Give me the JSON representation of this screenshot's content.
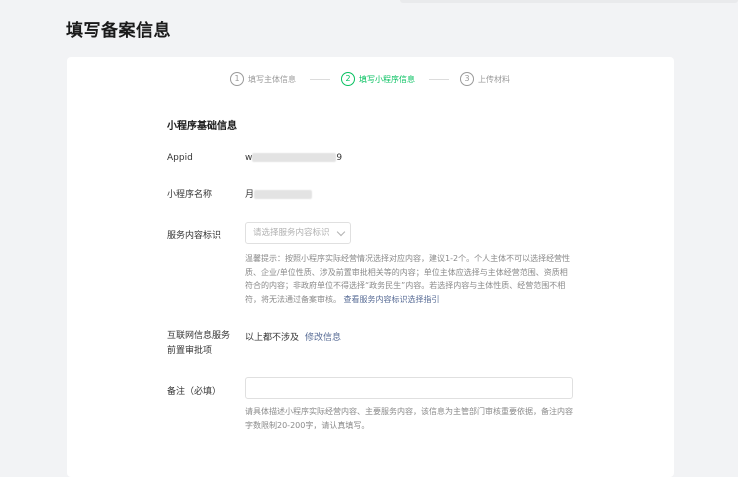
{
  "page": {
    "title": "填写备案信息"
  },
  "steps": [
    {
      "num": "1",
      "label": "填写主体信息",
      "active": false
    },
    {
      "num": "2",
      "label": "填写小程序信息",
      "active": true
    },
    {
      "num": "3",
      "label": "上传材料",
      "active": false
    }
  ],
  "form": {
    "section_title": "小程序基础信息",
    "appid": {
      "label": "Appid",
      "value_start": "w",
      "value_end": "9"
    },
    "name": {
      "label": "小程序名称",
      "value_start": "月"
    },
    "service": {
      "label": "服务内容标识",
      "placeholder": "请选择服务内容标识",
      "tip": "温馨提示：按照小程序实际经营情况选择对应内容，建议1-2个。个人主体不可以选择经营性质、企业/单位性质、涉及前置审批相关等的内容；单位主体应选择与主体经营范围、资质相符合的内容；非政府单位不得选择“政务民生”内容。若选择内容与主体性质、经营范围不相符，将无法通过备案审核。",
      "tip_link": "查看服务内容标识选择指引"
    },
    "approval": {
      "label_line1": "互联网信息服务",
      "label_line2": "前置审批项",
      "value": "以上都不涉及",
      "link": "修改信息"
    },
    "remark": {
      "label": "备注（必填）",
      "value": "",
      "hint": "请具体描述小程序实际经营内容、主要服务内容，该信息为主管部门审核重要依据，备注内容字数限制20-200字，请认真填写。"
    }
  },
  "colors": {
    "accent": "#07c160",
    "link": "#576b95"
  }
}
